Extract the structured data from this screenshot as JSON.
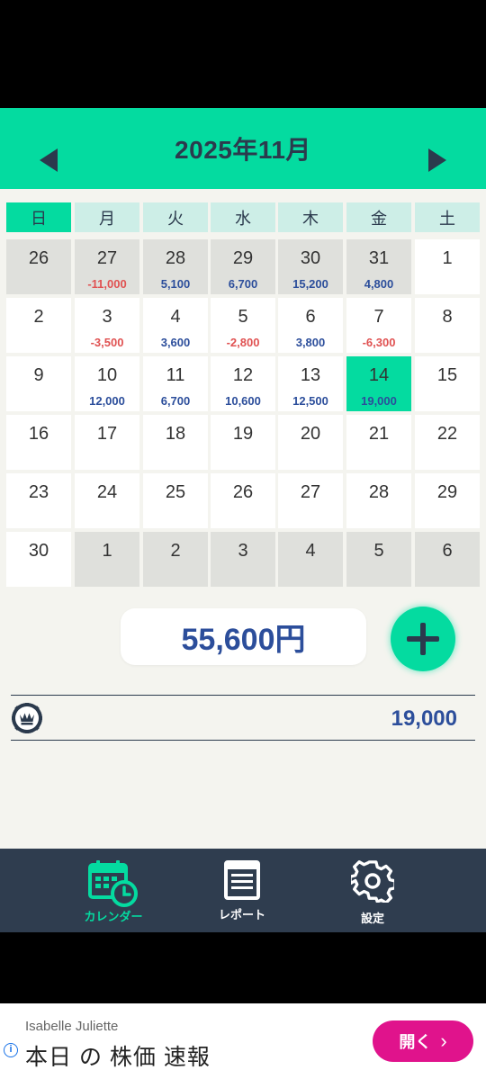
{
  "header": {
    "title": "2025年11月"
  },
  "weekdays": [
    "日",
    "月",
    "火",
    "水",
    "木",
    "金",
    "土"
  ],
  "weeks": [
    [
      {
        "d": "26",
        "other": true
      },
      {
        "d": "27",
        "other": true,
        "amt": "-11,000",
        "neg": true
      },
      {
        "d": "28",
        "other": true,
        "amt": "5,100"
      },
      {
        "d": "29",
        "other": true,
        "amt": "6,700"
      },
      {
        "d": "30",
        "other": true,
        "amt": "15,200"
      },
      {
        "d": "31",
        "other": true,
        "amt": "4,800"
      },
      {
        "d": "1"
      }
    ],
    [
      {
        "d": "2"
      },
      {
        "d": "3",
        "amt": "-3,500",
        "neg": true
      },
      {
        "d": "4",
        "amt": "3,600"
      },
      {
        "d": "5",
        "amt": "-2,800",
        "neg": true
      },
      {
        "d": "6",
        "amt": "3,800"
      },
      {
        "d": "7",
        "amt": "-6,300",
        "neg": true
      },
      {
        "d": "8"
      }
    ],
    [
      {
        "d": "9"
      },
      {
        "d": "10",
        "amt": "12,000"
      },
      {
        "d": "11",
        "amt": "6,700"
      },
      {
        "d": "12",
        "amt": "10,600"
      },
      {
        "d": "13",
        "amt": "12,500"
      },
      {
        "d": "14",
        "amt": "19,000",
        "today": true
      },
      {
        "d": "15"
      }
    ],
    [
      {
        "d": "16"
      },
      {
        "d": "17"
      },
      {
        "d": "18"
      },
      {
        "d": "19"
      },
      {
        "d": "20"
      },
      {
        "d": "21"
      },
      {
        "d": "22"
      }
    ],
    [
      {
        "d": "23"
      },
      {
        "d": "24"
      },
      {
        "d": "25"
      },
      {
        "d": "26"
      },
      {
        "d": "27"
      },
      {
        "d": "28"
      },
      {
        "d": "29"
      }
    ],
    [
      {
        "d": "30"
      },
      {
        "d": "1",
        "other": true
      },
      {
        "d": "2",
        "other": true
      },
      {
        "d": "3",
        "other": true
      },
      {
        "d": "4",
        "other": true
      },
      {
        "d": "5",
        "other": true
      },
      {
        "d": "6",
        "other": true
      }
    ]
  ],
  "summary": {
    "total": "55,600円"
  },
  "detail": {
    "value": "19,000",
    "icon": "casino-chip-icon"
  },
  "tabs": [
    {
      "label": "カレンダー",
      "icon": "calendar-clock-icon",
      "active": true
    },
    {
      "label": "レポート",
      "icon": "report-icon",
      "active": false
    },
    {
      "label": "設定",
      "icon": "gear-icon",
      "active": false
    }
  ],
  "ad": {
    "advertiser": "Isabelle Juliette",
    "headline": "本日 の 株価 速報",
    "cta": "開く",
    "cta_arrow": "›"
  },
  "colors": {
    "accent": "#04dba0",
    "navy": "#2b3a4d",
    "positive": "#2c4e9b",
    "negative": "#e05252",
    "tabbar": "#2f3d4f",
    "ad_cta": "#e0138c"
  }
}
